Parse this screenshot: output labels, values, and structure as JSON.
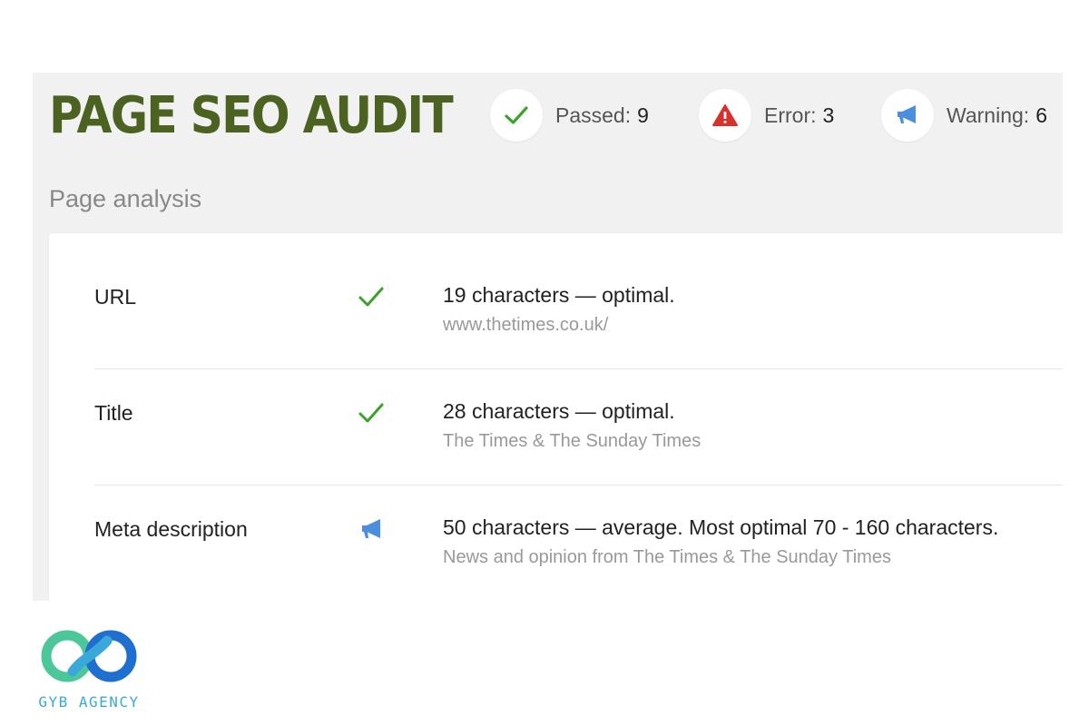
{
  "header": {
    "title": "PAGE SEO AUDIT",
    "stats": [
      {
        "label": "Passed:",
        "count": "9",
        "icon": "check-icon",
        "color": "#3da22a"
      },
      {
        "label": "Error:",
        "count": "3",
        "icon": "warning-triangle-icon",
        "color": "#d9302c"
      },
      {
        "label": "Warning:",
        "count": "6",
        "icon": "megaphone-icon",
        "color": "#4a8ee0"
      }
    ]
  },
  "section": {
    "title": "Page analysis"
  },
  "rows": [
    {
      "label": "URL",
      "status_icon": "check-icon",
      "main": "19 characters — optimal.",
      "sub": "www.thetimes.co.uk/"
    },
    {
      "label": "Title",
      "status_icon": "check-icon",
      "main": "28 characters — optimal.",
      "sub": "The Times & The Sunday Times"
    },
    {
      "label": "Meta description",
      "status_icon": "megaphone-icon",
      "main": "50 characters — average. Most optimal 70 - 160 characters.",
      "sub": "News and opinion from The Times & The Sunday Times"
    }
  ],
  "logo": {
    "text": "GYB AGENCY"
  },
  "colors": {
    "title": "#4c6220",
    "panel_background": "#f1f1f1",
    "passed": "#3da22a",
    "error": "#d9302c",
    "warning": "#4a8ee0",
    "logo_green": "#4cc79a",
    "logo_blue": "#1f6fd1"
  }
}
